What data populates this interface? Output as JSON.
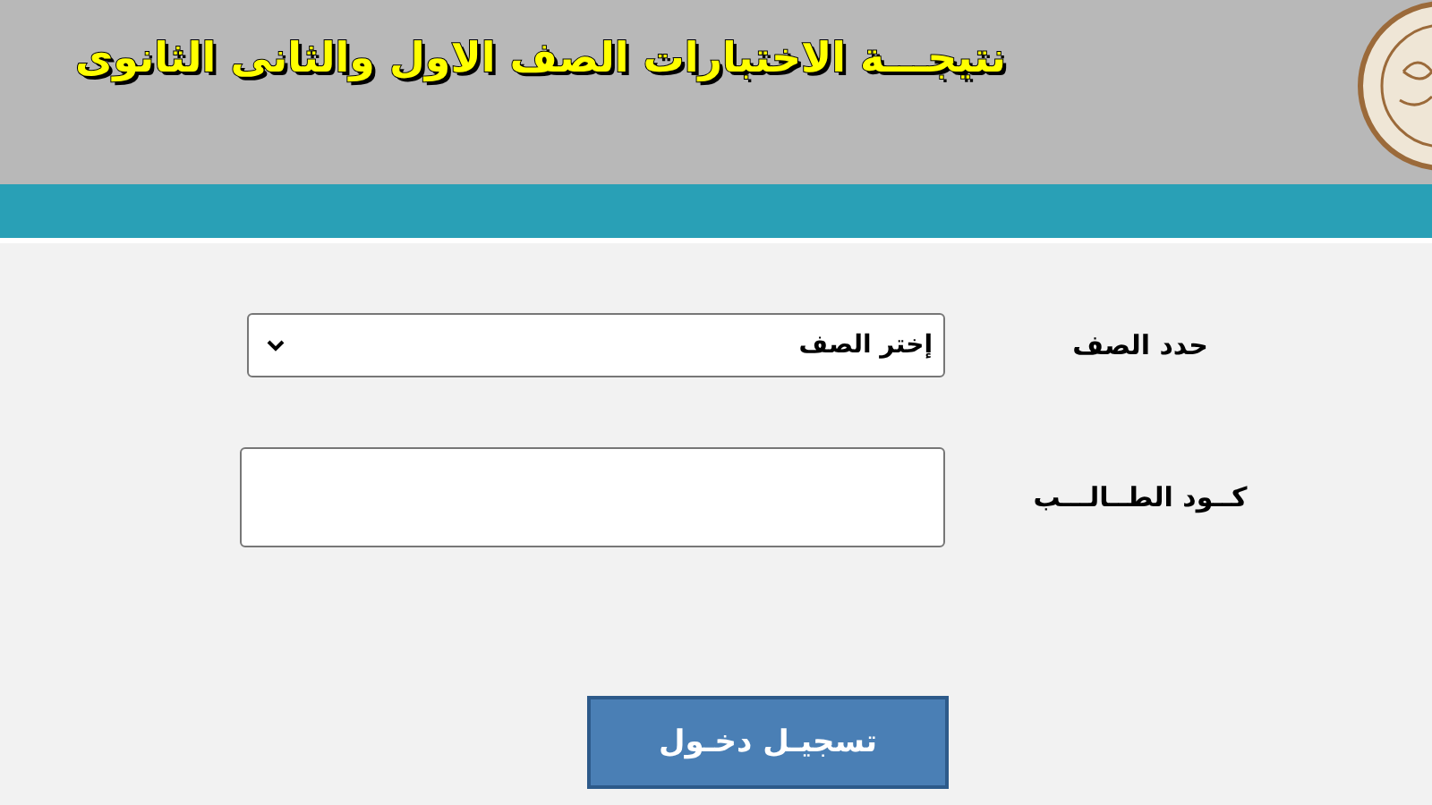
{
  "header": {
    "title": "نتيجـــة  الاختبارات الصف الاول والثانى الثانوى"
  },
  "form": {
    "fields": [
      {
        "kind": "select",
        "label": "حدد الصف",
        "value": "إختر الصف"
      },
      {
        "kind": "text",
        "label": "كــود الطــالـــب"
      }
    ],
    "submit": "تسجيـل دخـول"
  }
}
